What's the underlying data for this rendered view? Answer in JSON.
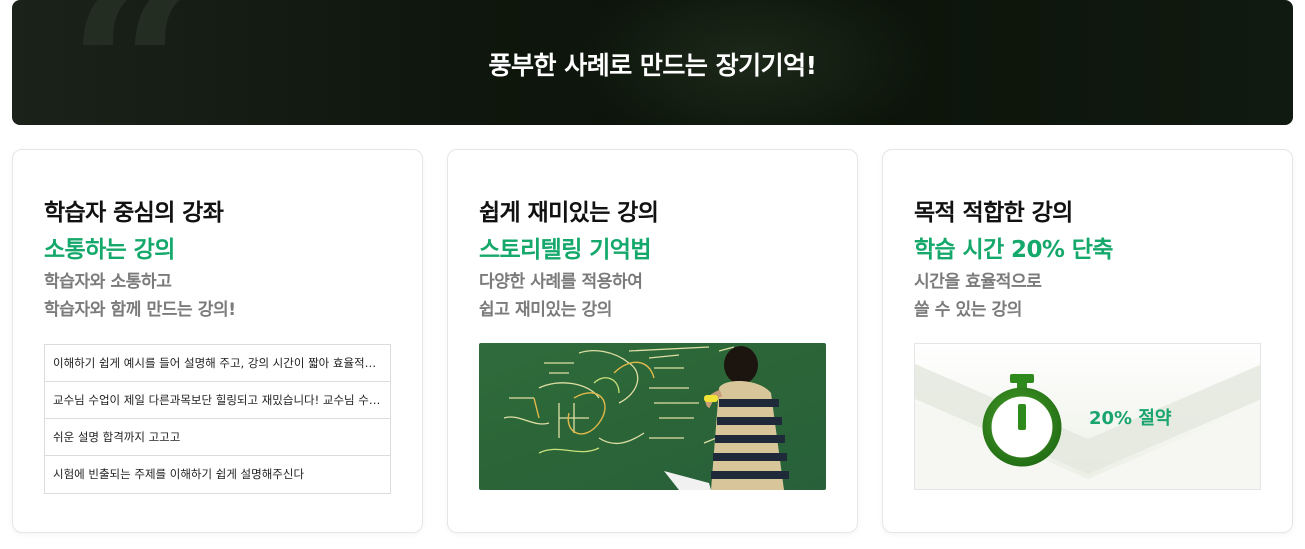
{
  "banner": {
    "title": "풍부한 사례로 만드는 장기기억!"
  },
  "cards": [
    {
      "heading": "학습자 중심의 강좌",
      "highlight": "소통하는 강의",
      "desc_lines": [
        "학습자와 소통하고",
        "학습자와 함께 만드는 강의!"
      ],
      "reviews": [
        "이해하기 쉽게 예시를 들어 설명해 주고, 강의 시간이 짧아 효율적으…",
        "교수님 수업이 제일 다른과목보단 힐링되고 재밌습니다! 교수님 수…",
        "쉬운 설명 합격까지 고고고",
        "시험에 빈출되는 주제를 이해하기 쉽게 설명해주신다"
      ]
    },
    {
      "heading": "쉽게 재미있는 강의",
      "highlight": "스토리텔링 기억법",
      "desc_lines": [
        "다양한 사례를 적용하여",
        "쉽고 재미있는 강의"
      ]
    },
    {
      "heading": "목적 적합한 강의",
      "highlight": "학습 시간 20% 단축",
      "desc_lines": [
        "시간을 효율적으로",
        "쓸 수 있는 강의"
      ],
      "saving_label": "20% 절약"
    }
  ],
  "colors": {
    "accent_green": "#15a86b",
    "banner_bg": "#0e160d",
    "chalkboard": "#2d6a3a"
  },
  "icons": {
    "banner_decoration": "quote-icon",
    "card3_icon": "stopwatch-icon"
  }
}
